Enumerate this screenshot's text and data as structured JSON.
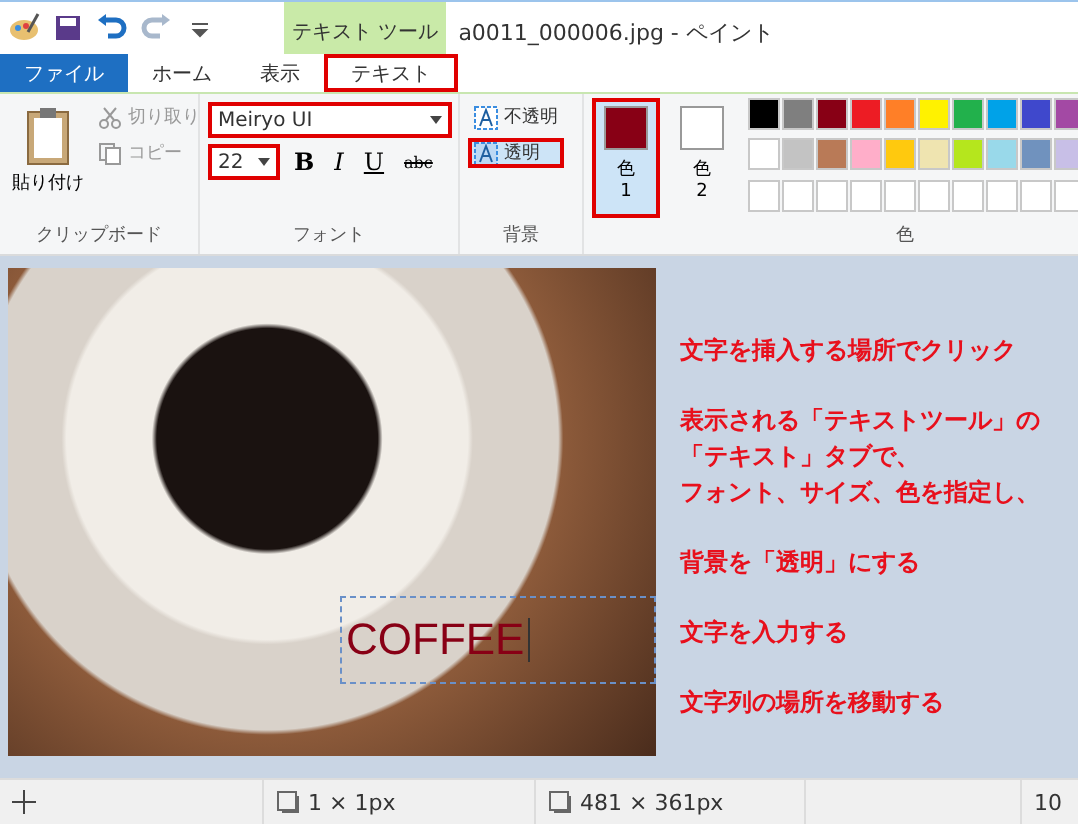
{
  "window": {
    "title": "a0011_000006.jpg - ペイント",
    "context_tab": "テキスト ツール"
  },
  "tabs": [
    {
      "label": "ファイル",
      "kind": "file",
      "selected": false,
      "highlighted": false
    },
    {
      "label": "ホーム",
      "kind": "tab",
      "selected": false,
      "highlighted": false
    },
    {
      "label": "表示",
      "kind": "tab",
      "selected": false,
      "highlighted": false
    },
    {
      "label": "テキスト",
      "kind": "tab",
      "selected": true,
      "highlighted": true
    }
  ],
  "clipboard": {
    "label": "クリップボード",
    "paste": "貼り付け",
    "cut": {
      "label": "切り取り",
      "disabled": true
    },
    "copy": {
      "label": "コピー",
      "disabled": true
    }
  },
  "font": {
    "label": "フォント",
    "family": {
      "value": "Meiryo UI",
      "highlighted": true
    },
    "size": {
      "value": "22",
      "highlighted": true
    },
    "styles": [
      {
        "label": "B",
        "kind": "bold"
      },
      {
        "label": "I",
        "kind": "italic"
      },
      {
        "label": "U",
        "kind": "underline"
      },
      {
        "label": "abc",
        "kind": "strike"
      }
    ]
  },
  "background": {
    "label": "背景",
    "options": [
      {
        "label": "不透明",
        "selected": false,
        "highlighted": false
      },
      {
        "label": "透明",
        "selected": true,
        "highlighted": true
      }
    ]
  },
  "colors": {
    "label": "色",
    "slots": [
      {
        "label": "色\n1",
        "color": "#880015",
        "selected": true,
        "highlighted": true
      },
      {
        "label": "色\n2",
        "color": "#ffffff",
        "selected": false,
        "highlighted": false
      }
    ],
    "palette": [
      {
        "color": "#000000"
      },
      {
        "color": "#7f7f7f"
      },
      {
        "color": "#880015"
      },
      {
        "color": "#ed1c24"
      },
      {
        "color": "#ff7f27"
      },
      {
        "color": "#fff200"
      },
      {
        "color": "#22b14c"
      },
      {
        "color": "#00a2e8"
      },
      {
        "color": "#3f48cc"
      },
      {
        "color": "#a349a4"
      },
      {
        "color": "#ffffff"
      },
      {
        "color": "#c3c3c3"
      },
      {
        "color": "#b97a57"
      },
      {
        "color": "#ffaec9"
      },
      {
        "color": "#ffc90e"
      },
      {
        "color": "#efe4b0"
      },
      {
        "color": "#b5e61d"
      },
      {
        "color": "#99d9ea"
      },
      {
        "color": "#7092be"
      },
      {
        "color": "#c8bfe7"
      }
    ]
  },
  "canvas": {
    "text_box": {
      "value": "COFFEE"
    }
  },
  "annotations": [
    {
      "lines": [
        "文字を挿入する場所でクリック"
      ]
    },
    {
      "lines": [
        "表示される「テキストツール」の",
        "「テキスト」タブで、",
        "フォント、サイズ、色を指定し、"
      ]
    },
    {
      "lines": [
        "背景を「透明」にする"
      ]
    },
    {
      "lines": [
        "文字を入力する"
      ]
    },
    {
      "lines": [
        "文字列の場所を移動する"
      ]
    }
  ],
  "status_bar": {
    "selection": "1 × 1px",
    "image_size": "481 × 361px",
    "zoom": "10"
  }
}
